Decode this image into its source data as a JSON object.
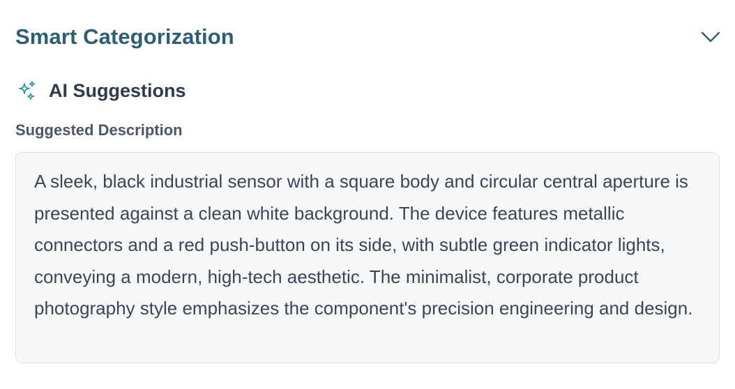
{
  "section": {
    "title": "Smart Categorization",
    "toggle_icon": "chevron-down-icon"
  },
  "ai": {
    "icon": "sparkles-icon",
    "label": "AI Suggestions"
  },
  "description": {
    "label": "Suggested Description",
    "value": "A sleek, black industrial sensor with a square body and circular central aperture is presented against a clean white background. The device features metallic connectors and a red push-button on its side, with subtle green indicator lights, conveying a modern, high-tech aesthetic. The minimalist, corporate product photography style emphasizes the component's precision engineering and design."
  },
  "colors": {
    "title": "#2c5f72",
    "accent": "#2f8f9d",
    "text": "#3b4556",
    "box_bg": "#f7f8fa",
    "box_border": "#dde1e6"
  }
}
